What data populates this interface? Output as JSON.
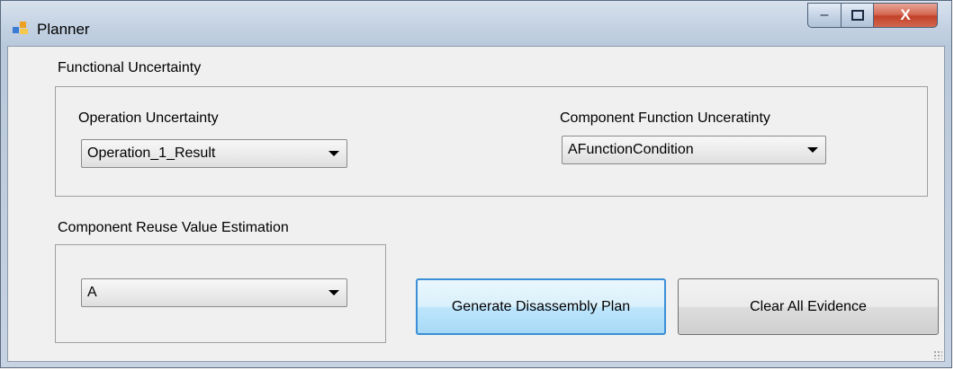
{
  "window": {
    "title": "Planner",
    "icon": "planner-app-icon",
    "controls": {
      "minimize_icon": "minimize-icon",
      "maximize_icon": "maximize-icon",
      "close_icon": "close-icon",
      "minimize_glyph": "–",
      "maximize_glyph": "▫",
      "close_glyph": "X"
    }
  },
  "functional_uncertainty": {
    "group_label": "Functional Uncertainty",
    "operation": {
      "label": "Operation Uncertainty",
      "selected": "Operation_1_Result"
    },
    "component_function": {
      "label": "Component Function Unceratinty",
      "selected": "AFunctionCondition"
    }
  },
  "reuse_value": {
    "group_label": "Component Reuse Value Estimation",
    "selected": "A"
  },
  "buttons": {
    "generate": "Generate Disassembly Plan",
    "clear": "Clear All Evidence"
  },
  "colors": {
    "close_button": "#c2412a",
    "focused_button_border": "#3c8fd6",
    "client_background": "#f0f0f0"
  }
}
